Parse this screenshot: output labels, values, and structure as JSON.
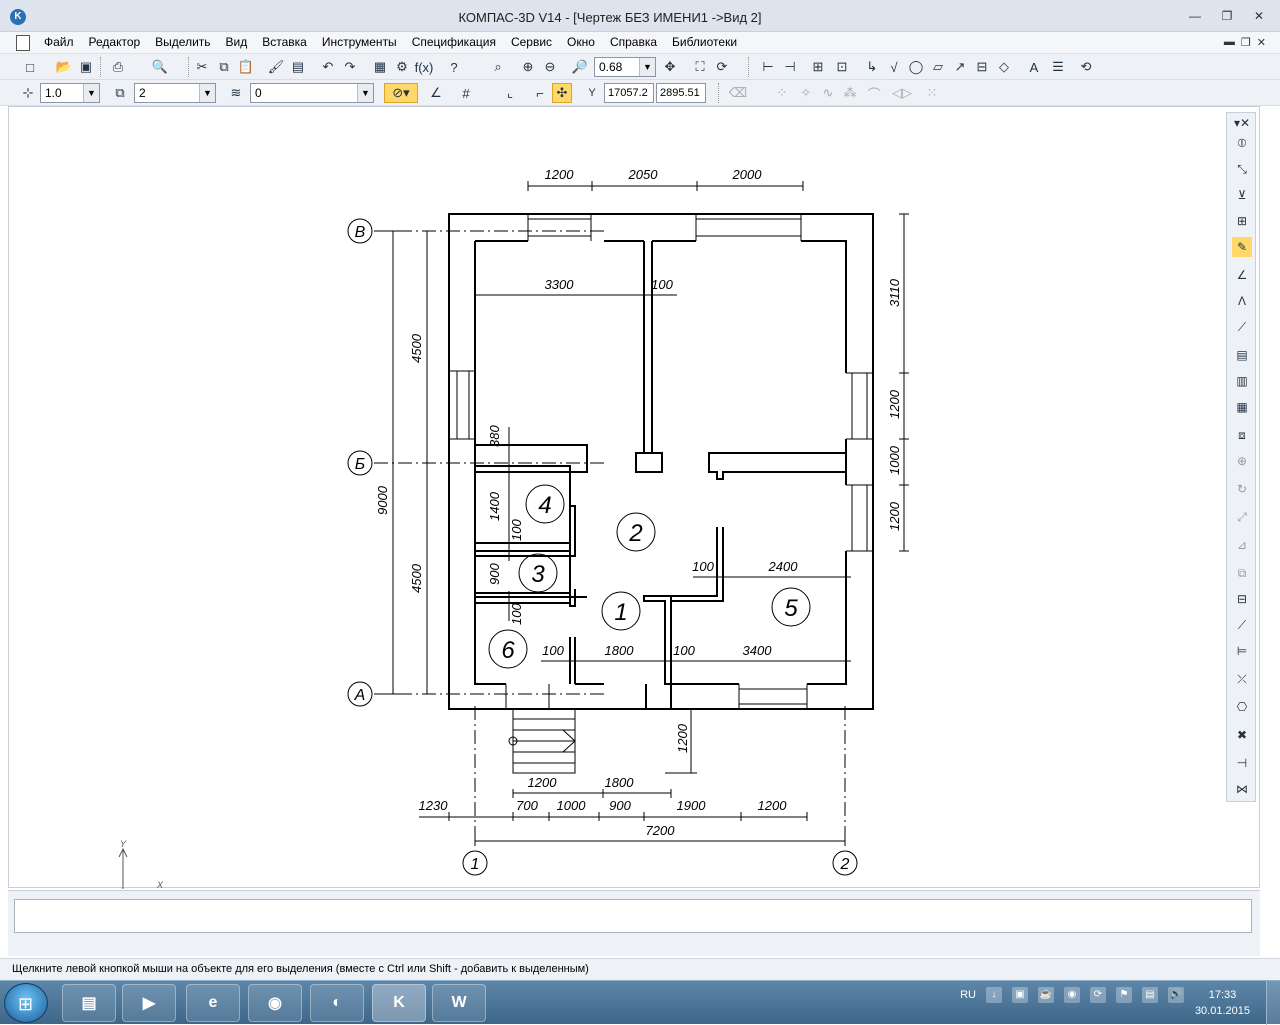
{
  "window": {
    "title": "КОМПАС-3D V14 - [Чертеж БЕЗ ИМЕНИ1 ->Вид 2]",
    "minimize_icon": "minimize-icon",
    "maximize_icon": "restore-icon",
    "close_icon": "close-icon"
  },
  "menu": {
    "items": [
      "Файл",
      "Редактор",
      "Выделить",
      "Вид",
      "Вставка",
      "Инструменты",
      "Спецификация",
      "Сервис",
      "Окно",
      "Справка",
      "Библиотеки"
    ]
  },
  "toolbar1": {
    "zoom_value": "0.68"
  },
  "toolbar2": {
    "scale_value": "1.0",
    "layer_value": "2",
    "style_value": "0",
    "coord_label": "Y",
    "coord_x": "17057.2",
    "coord_y": "2895.51"
  },
  "drawing": {
    "top_dims": [
      "1200",
      "2050",
      "2000"
    ],
    "inner_dims": [
      "3300",
      "100",
      "380",
      "1400",
      "100",
      "900",
      "100",
      "100",
      "2400",
      "100",
      "1800",
      "100",
      "3400",
      "1200"
    ],
    "right_dims": [
      "3110",
      "1200",
      "1000",
      "1200"
    ],
    "left_dims": [
      "4500",
      "9000",
      "4500"
    ],
    "bottom_dims_row1": [
      "1200",
      "1800"
    ],
    "bottom_dims_row2": [
      "1230",
      "700",
      "1000",
      "900",
      "1900",
      "1200"
    ],
    "total_dim": "7200",
    "axis_letters": [
      "В",
      "Б",
      "А"
    ],
    "axis_numbers": [
      "1",
      "2"
    ],
    "rooms": [
      "1",
      "2",
      "3",
      "4",
      "5",
      "6"
    ],
    "ucs_y": "Y",
    "ucs_x": "X"
  },
  "status": {
    "hint": "Щелкните левой кнопкой мыши на объекте для его выделения (вместе с Ctrl или Shift - добавить к выделенным)"
  },
  "taskbar": {
    "apps": [
      {
        "name": "explorer",
        "icon": "folder-icon",
        "glyph": "▤"
      },
      {
        "name": "media-player",
        "icon": "media-player-icon",
        "glyph": "▶"
      },
      {
        "name": "ie",
        "icon": "internet-explorer-icon",
        "glyph": "e"
      },
      {
        "name": "chrome",
        "icon": "chrome-icon",
        "glyph": "◉"
      },
      {
        "name": "app-red",
        "icon": "red-app-icon",
        "glyph": "◐"
      },
      {
        "name": "kompas",
        "icon": "kompas-icon",
        "glyph": "K"
      },
      {
        "name": "word",
        "icon": "word-icon",
        "glyph": "W"
      }
    ],
    "lang": "RU",
    "time": "17:33",
    "date": "30.01.2015"
  }
}
